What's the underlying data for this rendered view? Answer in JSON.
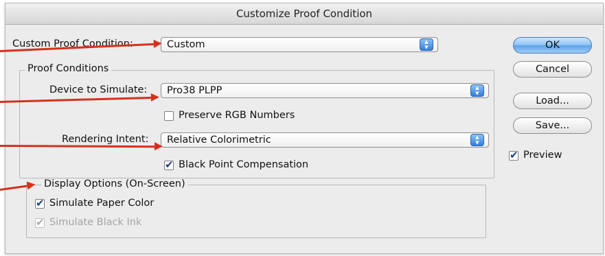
{
  "window": {
    "title": "Customize Proof Condition"
  },
  "custom_proof_condition": {
    "label": "Custom Proof Condition:",
    "value": "Custom"
  },
  "proof_conditions": {
    "legend": "Proof Conditions",
    "device_label": "Device to Simulate:",
    "device_value": "Pro38 PLPP",
    "preserve_rgb": {
      "label": "Preserve RGB Numbers",
      "checked": false
    },
    "intent_label": "Rendering Intent:",
    "intent_value": "Relative Colorimetric",
    "black_point": {
      "label": "Black Point Compensation",
      "checked": true
    }
  },
  "display_options": {
    "legend": "Display Options (On-Screen)",
    "paper_color": {
      "label": "Simulate Paper Color",
      "checked": true
    },
    "black_ink": {
      "label": "Simulate Black Ink",
      "checked": true,
      "disabled": true
    }
  },
  "buttons": {
    "ok": "OK",
    "cancel": "Cancel",
    "load": "Load...",
    "save": "Save..."
  },
  "preview": {
    "label": "Preview",
    "checked": true
  },
  "colors": {
    "annotation_arrow": "#d6301c",
    "default_button": "#5aa2ea"
  }
}
